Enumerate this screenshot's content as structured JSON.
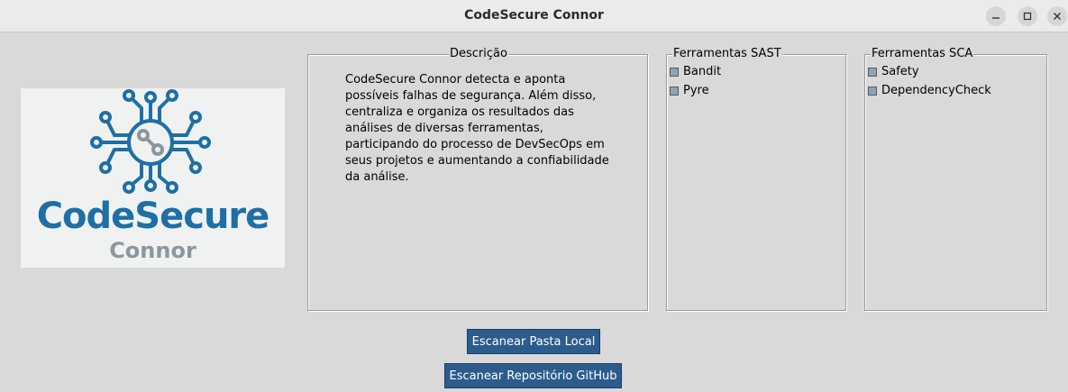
{
  "window": {
    "title": "CodeSecure Connor"
  },
  "logo": {
    "main_text": "CodeSecure",
    "sub_text": "Connor"
  },
  "description": {
    "label": "Descrição",
    "lines": [
      "CodeSecure Connor detecta e aponta",
      "possíveis falhas de segurança. Além disso,",
      "centraliza e organiza os resultados das",
      "análises de diversas ferramentas,",
      "participando do processo de DevSecOps em",
      "seus projetos e aumentando a confiabilidade",
      "da análise."
    ]
  },
  "sast": {
    "label": "Ferramentas SAST",
    "items": [
      {
        "label": "Bandit",
        "checked": false
      },
      {
        "label": "Pyre",
        "checked": false
      }
    ]
  },
  "sca": {
    "label": "Ferramentas SCA",
    "items": [
      {
        "label": "Safety",
        "checked": false
      },
      {
        "label": "DependencyCheck",
        "checked": false
      }
    ]
  },
  "actions": {
    "scan_local_label": "Escanear Pasta Local",
    "scan_github_label": "Escanear Repositório GitHub"
  },
  "colors": {
    "window_bg": "#d9d9d9",
    "button_bg": "#2c5c8c",
    "logo_blue": "#1e6fa6",
    "logo_gray": "#8a979f"
  }
}
